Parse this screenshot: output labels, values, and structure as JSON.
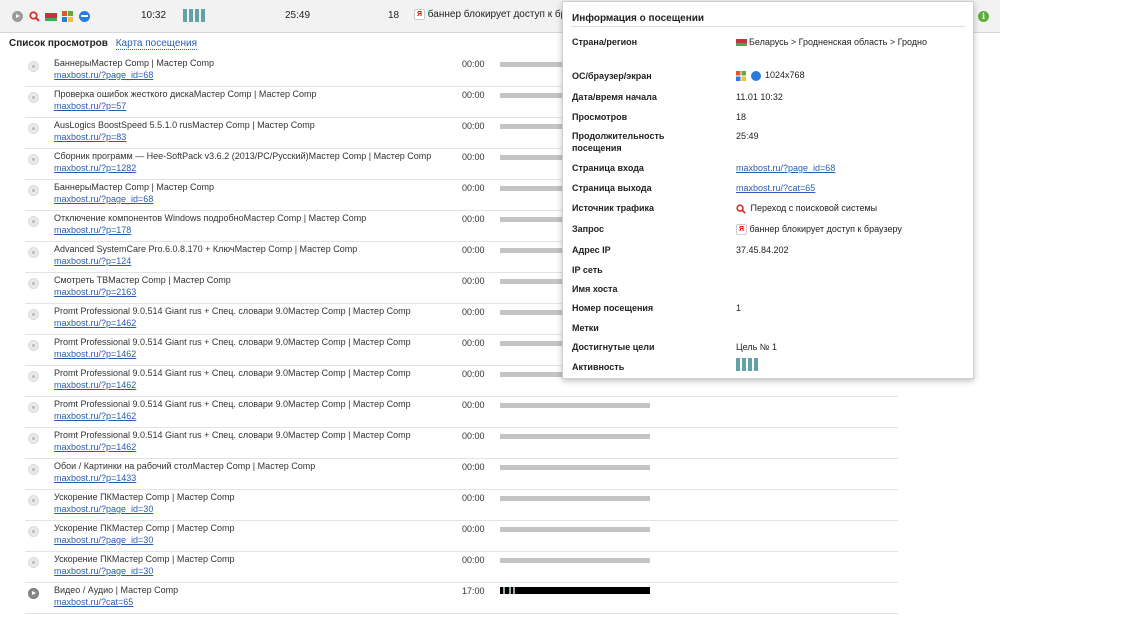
{
  "topbar": {
    "time": "10:32",
    "activity_level": 4,
    "duration": "25:49",
    "views": "18",
    "query": "баннер блокирует доступ к браузеру",
    "colors": {
      "activity": "#62a1a6",
      "info_icon": "#5cae3a"
    }
  },
  "tabs": {
    "active": "Список просмотров",
    "link": "Карта посещения"
  },
  "rows": [
    {
      "title": "БаннерыМастер Comp | Мастер Comp",
      "url": "maxbost.ru/?page_id=68",
      "time": "00:00"
    },
    {
      "title": "Проверка ошибок жесткого дискаМастер Comp | Мастер Comp",
      "url": "maxbost.ru/?p=57",
      "time": "00:00"
    },
    {
      "title": "AusLogics BoostSpeed 5.5.1.0 rusМастер Comp | Мастер Comp",
      "url": "maxbost.ru/?p=83",
      "time": "00:00"
    },
    {
      "title": "Сборник программ — Hee-SoftPack v3.6.2 (2013/PC/Русский)Мастер Comp | Мастер Comp",
      "url": "maxbost.ru/?p=1282",
      "time": "00:00"
    },
    {
      "title": "БаннерыМастер Comp | Мастер Comp",
      "url": "maxbost.ru/?page_id=68",
      "time": "00:00"
    },
    {
      "title": "Отключение компонентов Windows подробноМастер Comp | Мастер Comp",
      "url": "maxbost.ru/?p=178",
      "time": "00:00"
    },
    {
      "title": "Advanced SystemCare Pro.6.0.8.170 + КлючМастер Comp | Мастер Comp",
      "url": "maxbost.ru/?p=124",
      "time": "00:00"
    },
    {
      "title": "Смотреть ТВМастер Comp | Мастер Comp",
      "url": "maxbost.ru/?p=2163",
      "time": "00:00"
    },
    {
      "title": "Promt Professional 9.0.514 Giant rus + Спец. словари 9.0Мастер Comp | Мастер Comp",
      "url": "maxbost.ru/?p=1462",
      "time": "00:00"
    },
    {
      "title": "Promt Professional 9.0.514 Giant rus + Спец. словари 9.0Мастер Comp | Мастер Comp",
      "url": "maxbost.ru/?p=1462",
      "time": "00:00"
    },
    {
      "title": "Promt Professional 9.0.514 Giant rus + Спец. словари 9.0Мастер Comp | Мастер Comp",
      "url": "maxbost.ru/?p=1462",
      "time": "00:00"
    },
    {
      "title": "Promt Professional 9.0.514 Giant rus + Спец. словари 9.0Мастер Comp | Мастер Comp",
      "url": "maxbost.ru/?p=1462",
      "time": "00:00"
    },
    {
      "title": "Promt Professional 9.0.514 Giant rus + Спец. словари 9.0Мастер Comp | Мастер Comp",
      "url": "maxbost.ru/?p=1462",
      "time": "00:00"
    },
    {
      "title": "Обои / Картинки на рабочий столМастер Comp | Мастер Comp",
      "url": "maxbost.ru/?p=1433",
      "time": "00:00"
    },
    {
      "title": "Ускорение ПКМастер Comp | Мастер Comp",
      "url": "maxbost.ru/?page_id=30",
      "time": "00:00"
    },
    {
      "title": "Ускорение ПКМастер Comp | Мастер Comp",
      "url": "maxbost.ru/?page_id=30",
      "time": "00:00"
    },
    {
      "title": "Ускорение ПКМастер Comp | Мастер Comp",
      "url": "maxbost.ru/?page_id=30",
      "time": "00:00"
    },
    {
      "title": "Видео / Аудио | Мастер Comp",
      "url": "maxbost.ru/?cat=65",
      "time": "17:00",
      "playable": true
    }
  ],
  "popup": {
    "title": "Информация о посещении",
    "country_label": "Страна/регион",
    "country_value": "Беларусь > Гродненская область > Гродно",
    "os_label": "ОС/браузер/экран",
    "os_value": "1024x768",
    "start_label": "Дата/время начала",
    "start_value": "11.01 10:32",
    "views_label": "Просмотров",
    "views_value": "18",
    "duration_label": "Продолжительность посещения",
    "duration_value": "25:49",
    "entry_label": "Страница входа",
    "entry_value": "maxbost.ru/?page_id=68",
    "exit_label": "Страница выхода",
    "exit_value": "maxbost.ru/?cat=65",
    "source_label": "Источник трафика",
    "source_value": "Переход с поисковой системы",
    "query_label": "Запрос",
    "query_value": "баннер блокирует доступ к браузеру",
    "ip_label": "Адрес IP",
    "ip_value": "37.45.84.202",
    "ipnet_label": "IP сеть",
    "host_label": "Имя хоста",
    "visitnum_label": "Номер посещения",
    "visitnum_value": "1",
    "tags_label": "Метки",
    "goals_label": "Достигнутые цели",
    "goals_value": "Цель № 1",
    "activity_label": "Активность",
    "activity_level": 4
  }
}
